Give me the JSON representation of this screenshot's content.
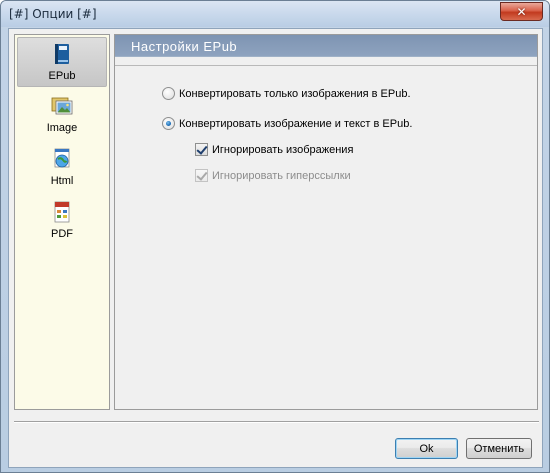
{
  "window": {
    "title": "[#] Опции [#]",
    "close_glyph": "✕"
  },
  "sidebar": {
    "items": [
      {
        "label": "EPub",
        "icon": "epub-book-icon",
        "selected": true
      },
      {
        "label": "Image",
        "icon": "image-icon",
        "selected": false
      },
      {
        "label": "Html",
        "icon": "html-globe-icon",
        "selected": false
      },
      {
        "label": "PDF",
        "icon": "pdf-document-icon",
        "selected": false
      }
    ]
  },
  "panel": {
    "title": "Настройки EPub",
    "options": {
      "images_only": {
        "label": "Конвертировать только изображения в EPub.",
        "checked": false
      },
      "image_and_text": {
        "label": "Конвертировать изображение и текст в EPub.",
        "checked": true
      },
      "ignore_images": {
        "label": "Игнорировать изображения",
        "checked": true,
        "enabled": true
      },
      "ignore_links": {
        "label": "Игнорировать гиперссылки",
        "checked": true,
        "enabled": false
      }
    }
  },
  "buttons": {
    "ok": "Ok",
    "cancel": "Отменить"
  },
  "colors": {
    "header_bg": "#7e94b2",
    "sidebar_bg": "#fcfbe8",
    "close_red": "#c23a1f"
  }
}
